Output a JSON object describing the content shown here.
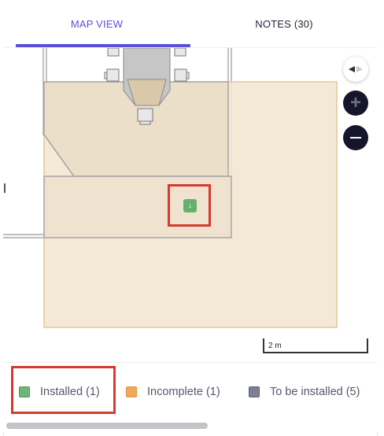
{
  "tabs": [
    {
      "label": "MAP VIEW",
      "active": true
    },
    {
      "label": "NOTES (30)",
      "active": false
    }
  ],
  "map": {
    "controls": {
      "compass_icon": "compass-icon",
      "zoom_in_icon": "plus-icon",
      "zoom_out_icon": "minus-icon"
    },
    "pin": {
      "glyph": "↓",
      "status": "installed",
      "color": "#66b06f"
    },
    "scale_label": "2 m"
  },
  "legend": {
    "items": [
      {
        "label": "Installed (1)",
        "color": "#6fb577"
      },
      {
        "label": "Incomplete (1)",
        "color": "#f1a958"
      },
      {
        "label": "To be installed (5)",
        "color": "#7d7f93"
      }
    ]
  },
  "colors": {
    "accent": "#5b4fd8",
    "highlight": "#d63a31",
    "zone_fill": "#f3e6d1",
    "zone_stroke": "#e2c796"
  }
}
